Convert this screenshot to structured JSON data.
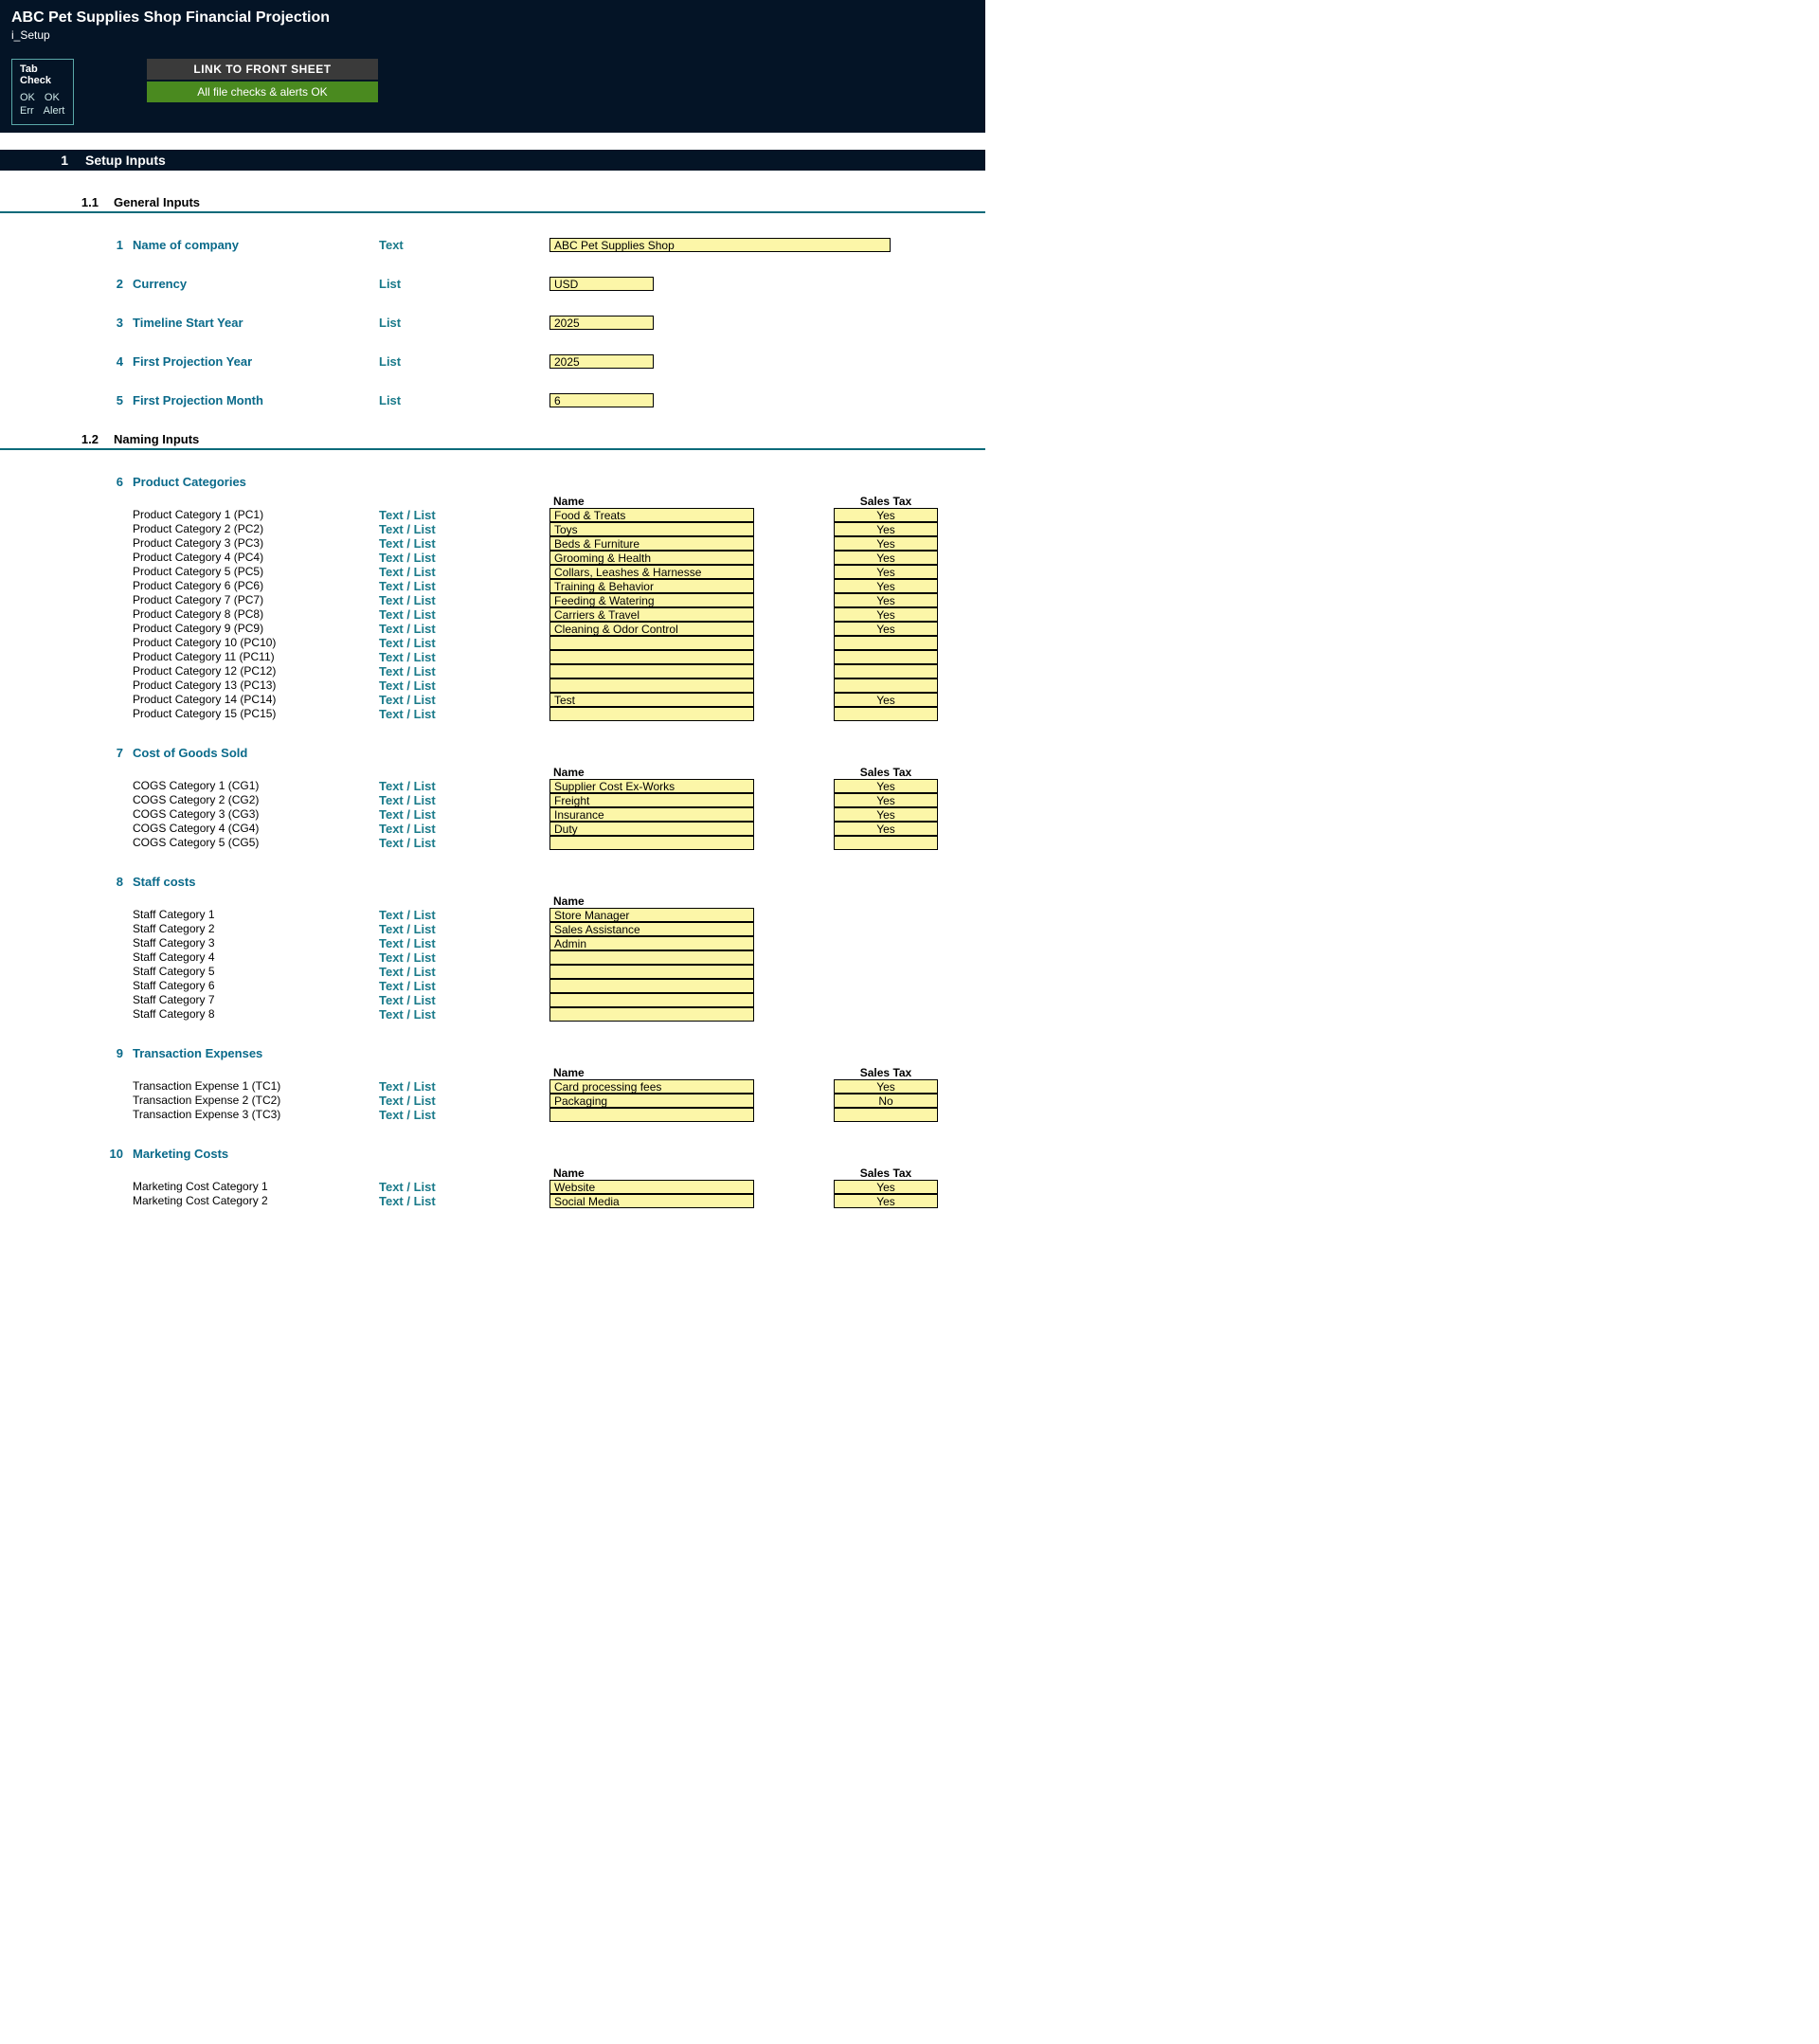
{
  "header": {
    "title": "ABC Pet Supplies Shop Financial Projection",
    "subtitle": "i_Setup",
    "tab_check_title": "Tab Check",
    "tab_ok1": "OK",
    "tab_ok2": "OK",
    "tab_err": "Err",
    "tab_alert": "Alert",
    "link_front": "LINK TO FRONT SHEET",
    "alerts_ok": "All file checks & alerts OK"
  },
  "section1": {
    "num": "1",
    "title": "Setup Inputs"
  },
  "sub11": {
    "num": "1.1",
    "title": "General Inputs"
  },
  "sub12": {
    "num": "1.2",
    "title": "Naming Inputs"
  },
  "col_name": "Name",
  "col_sales_tax": "Sales Tax",
  "type_text": "Text",
  "type_list": "List",
  "type_textlist": "Text / List",
  "general": [
    {
      "i": "1",
      "label": "Name of company",
      "type": "Text",
      "val": "ABC Pet Supplies Shop",
      "wide": true
    },
    {
      "i": "2",
      "label": "Currency",
      "type": "List",
      "val": "USD"
    },
    {
      "i": "3",
      "label": "Timeline Start Year",
      "type": "List",
      "val": "2025"
    },
    {
      "i": "4",
      "label": "First Projection Year",
      "type": "List",
      "val": "2025"
    },
    {
      "i": "5",
      "label": "First Projection Month",
      "type": "List",
      "val": "6"
    }
  ],
  "groups": [
    {
      "i": "6",
      "title": "Product Categories",
      "has_sales_tax": true,
      "items": [
        {
          "label": "Product Category 1 (PC1)",
          "name": "Food & Treats",
          "tax": "Yes"
        },
        {
          "label": "Product Category 2 (PC2)",
          "name": "Toys",
          "tax": "Yes"
        },
        {
          "label": "Product Category 3 (PC3)",
          "name": "Beds & Furniture",
          "tax": "Yes"
        },
        {
          "label": "Product Category 4 (PC4)",
          "name": "Grooming & Health",
          "tax": "Yes"
        },
        {
          "label": "Product Category 5 (PC5)",
          "name": "Collars, Leashes & Harnesse",
          "tax": "Yes"
        },
        {
          "label": "Product Category 6 (PC6)",
          "name": "Training & Behavior",
          "tax": "Yes"
        },
        {
          "label": "Product Category 7 (PC7)",
          "name": "Feeding & Watering",
          "tax": "Yes"
        },
        {
          "label": "Product Category 8 (PC8)",
          "name": "Carriers & Travel",
          "tax": "Yes"
        },
        {
          "label": "Product Category 9 (PC9)",
          "name": "Cleaning & Odor Control",
          "tax": "Yes"
        },
        {
          "label": "Product Category 10 (PC10)",
          "name": "",
          "tax": ""
        },
        {
          "label": "Product Category 11 (PC11)",
          "name": "",
          "tax": ""
        },
        {
          "label": "Product Category 12 (PC12)",
          "name": "",
          "tax": ""
        },
        {
          "label": "Product Category 13 (PC13)",
          "name": "",
          "tax": ""
        },
        {
          "label": "Product Category 14 (PC14)",
          "name": "Test",
          "tax": "Yes"
        },
        {
          "label": "Product Category 15 (PC15)",
          "name": "",
          "tax": ""
        }
      ]
    },
    {
      "i": "7",
      "title": "Cost of Goods Sold",
      "has_sales_tax": true,
      "items": [
        {
          "label": "COGS Category 1 (CG1)",
          "name": "Supplier Cost Ex-Works",
          "tax": "Yes"
        },
        {
          "label": "COGS Category 2 (CG2)",
          "name": "Freight",
          "tax": "Yes"
        },
        {
          "label": "COGS Category 3 (CG3)",
          "name": "Insurance",
          "tax": "Yes"
        },
        {
          "label": "COGS Category 4 (CG4)",
          "name": "Duty",
          "tax": "Yes"
        },
        {
          "label": "COGS Category 5 (CG5)",
          "name": "",
          "tax": ""
        }
      ]
    },
    {
      "i": "8",
      "title": "Staff costs",
      "has_sales_tax": false,
      "items": [
        {
          "label": "Staff Category 1",
          "name": "Store Manager",
          "tax": ""
        },
        {
          "label": "Staff Category 2",
          "name": "Sales Assistance",
          "tax": ""
        },
        {
          "label": "Staff Category 3",
          "name": "Admin",
          "tax": ""
        },
        {
          "label": "Staff Category 4",
          "name": "",
          "tax": ""
        },
        {
          "label": "Staff Category 5",
          "name": "",
          "tax": ""
        },
        {
          "label": "Staff Category 6",
          "name": "",
          "tax": ""
        },
        {
          "label": "Staff Category 7",
          "name": "",
          "tax": ""
        },
        {
          "label": "Staff Category 8",
          "name": "",
          "tax": ""
        }
      ]
    },
    {
      "i": "9",
      "title": "Transaction Expenses",
      "has_sales_tax": true,
      "items": [
        {
          "label": "Transaction Expense 1 (TC1)",
          "name": "Card processing fees",
          "tax": "Yes"
        },
        {
          "label": "Transaction Expense 2 (TC2)",
          "name": "Packaging",
          "tax": "No"
        },
        {
          "label": "Transaction Expense 3 (TC3)",
          "name": "",
          "tax": ""
        }
      ]
    },
    {
      "i": "10",
      "title": "Marketing Costs",
      "has_sales_tax": true,
      "items": [
        {
          "label": "Marketing Cost Category 1",
          "name": "Website",
          "tax": "Yes"
        },
        {
          "label": "Marketing Cost Category 2",
          "name": "Social Media",
          "tax": "Yes"
        }
      ]
    }
  ]
}
